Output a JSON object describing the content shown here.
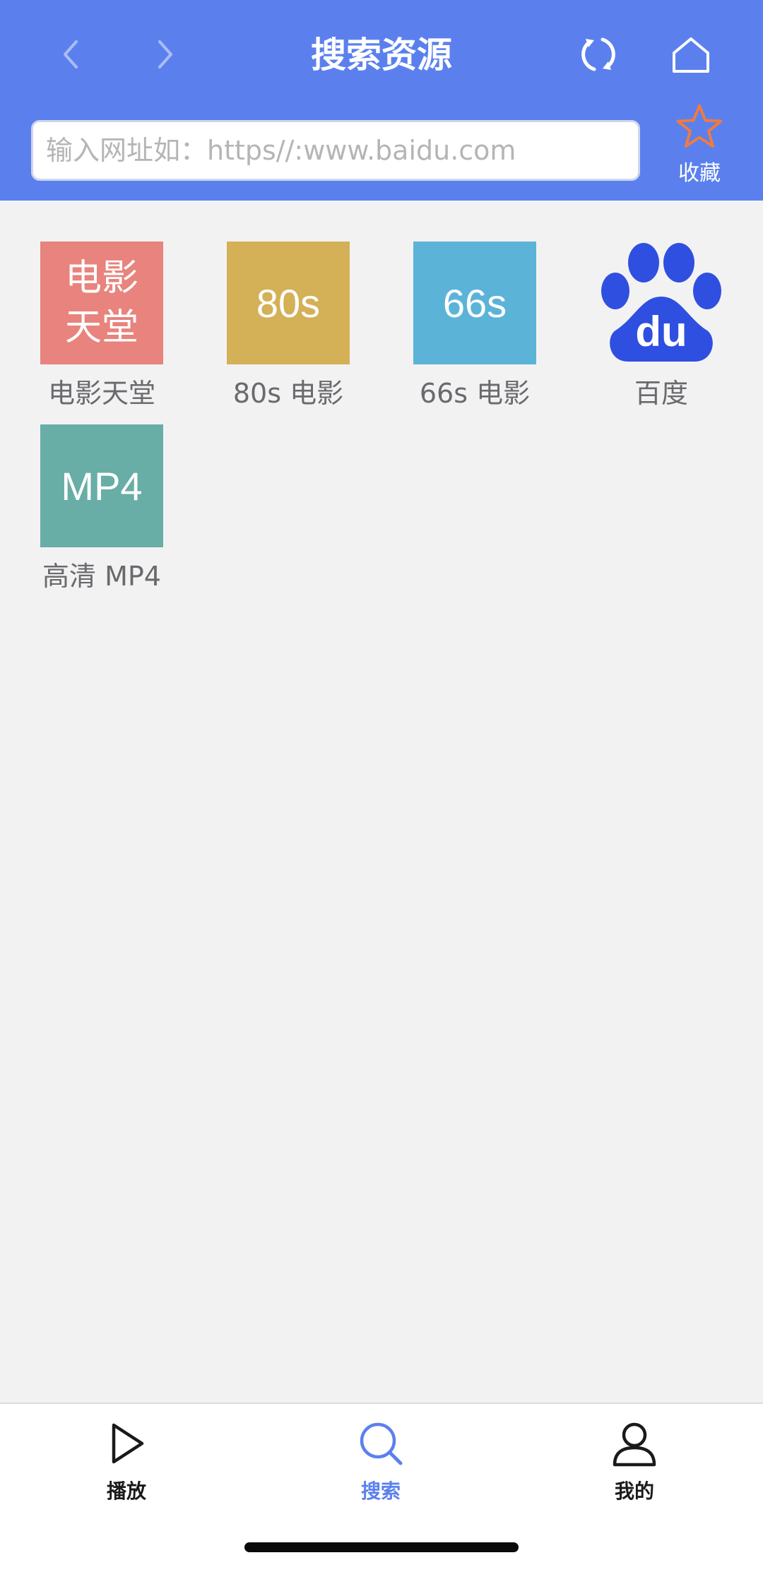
{
  "header": {
    "title": "搜索资源",
    "search_placeholder": "输入网址如：https//:www.baidu.com",
    "favorite_label": "收藏",
    "accent_color": "#5b80ee",
    "favorite_color": "#f07b3f"
  },
  "sites": [
    {
      "label": "电影天堂",
      "tile_text": "电影\n天堂",
      "color": "#e8837d",
      "icon": "movie-heaven-logo"
    },
    {
      "label": "80s 电影",
      "tile_text": "80s",
      "color": "#d4b057",
      "icon": "80s-logo"
    },
    {
      "label": "66s 电影",
      "tile_text": "66s",
      "color": "#5cb3d8",
      "icon": "66s-logo"
    },
    {
      "label": "百度",
      "tile_text": "du",
      "color": "#2f4fe0",
      "icon": "baidu-paw-logo"
    },
    {
      "label": "高清 MP4",
      "tile_text": "MP4",
      "color": "#68ada6",
      "icon": "mp4-logo"
    }
  ],
  "tabbar": {
    "tabs": [
      {
        "label": "播放",
        "icon": "play-icon",
        "active": false
      },
      {
        "label": "搜索",
        "icon": "search-icon",
        "active": true
      },
      {
        "label": "我的",
        "icon": "user-icon",
        "active": false
      }
    ]
  }
}
